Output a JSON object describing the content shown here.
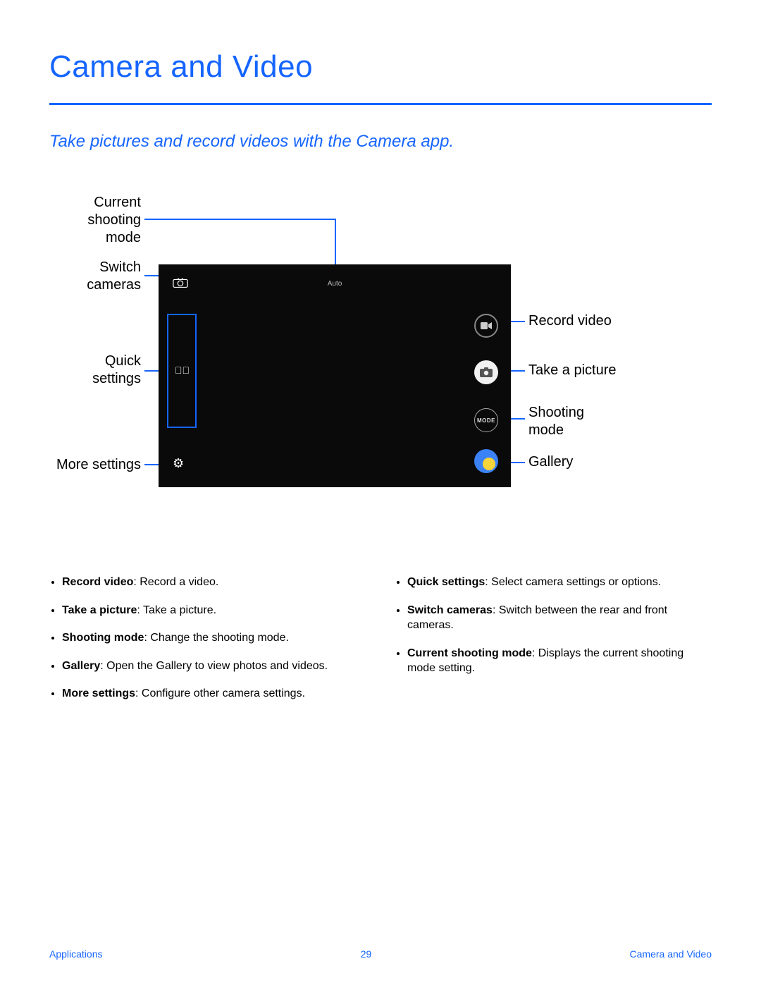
{
  "title": "Camera and Video",
  "subtitle": "Take pictures and record videos with the Camera app.",
  "callouts": {
    "current_mode": "Current\nshooting\nmode",
    "switch_cameras": "Switch\ncameras",
    "quick_settings": "Quick\nsettings",
    "more_settings": "More settings",
    "record_video": "Record video",
    "take_picture": "Take a picture",
    "shooting_mode": "Shooting\nmode",
    "gallery": "Gallery"
  },
  "camera_ui": {
    "mode_label": "Auto",
    "mode_button_text": "MODE"
  },
  "bullets_left": [
    {
      "term": "Record video",
      "desc": ": Record a video."
    },
    {
      "term": "Take a picture",
      "desc": ": Take a picture."
    },
    {
      "term": "Shooting mode",
      "desc": ": Change the shooting mode."
    },
    {
      "term": "Gallery",
      "desc": ": Open the Gallery to view photos and videos."
    },
    {
      "term": "More settings",
      "desc": ": Configure other camera settings."
    }
  ],
  "bullets_right": [
    {
      "term": "Quick settings",
      "desc": ": Select camera settings or options."
    },
    {
      "term": "Switch cameras",
      "desc": ": Switch between the rear and front cameras."
    },
    {
      "term": "Current shooting mode",
      "desc": ": Displays the current shooting mode setting."
    }
  ],
  "footer": {
    "left": "Applications",
    "center": "29",
    "right": "Camera and Video"
  }
}
